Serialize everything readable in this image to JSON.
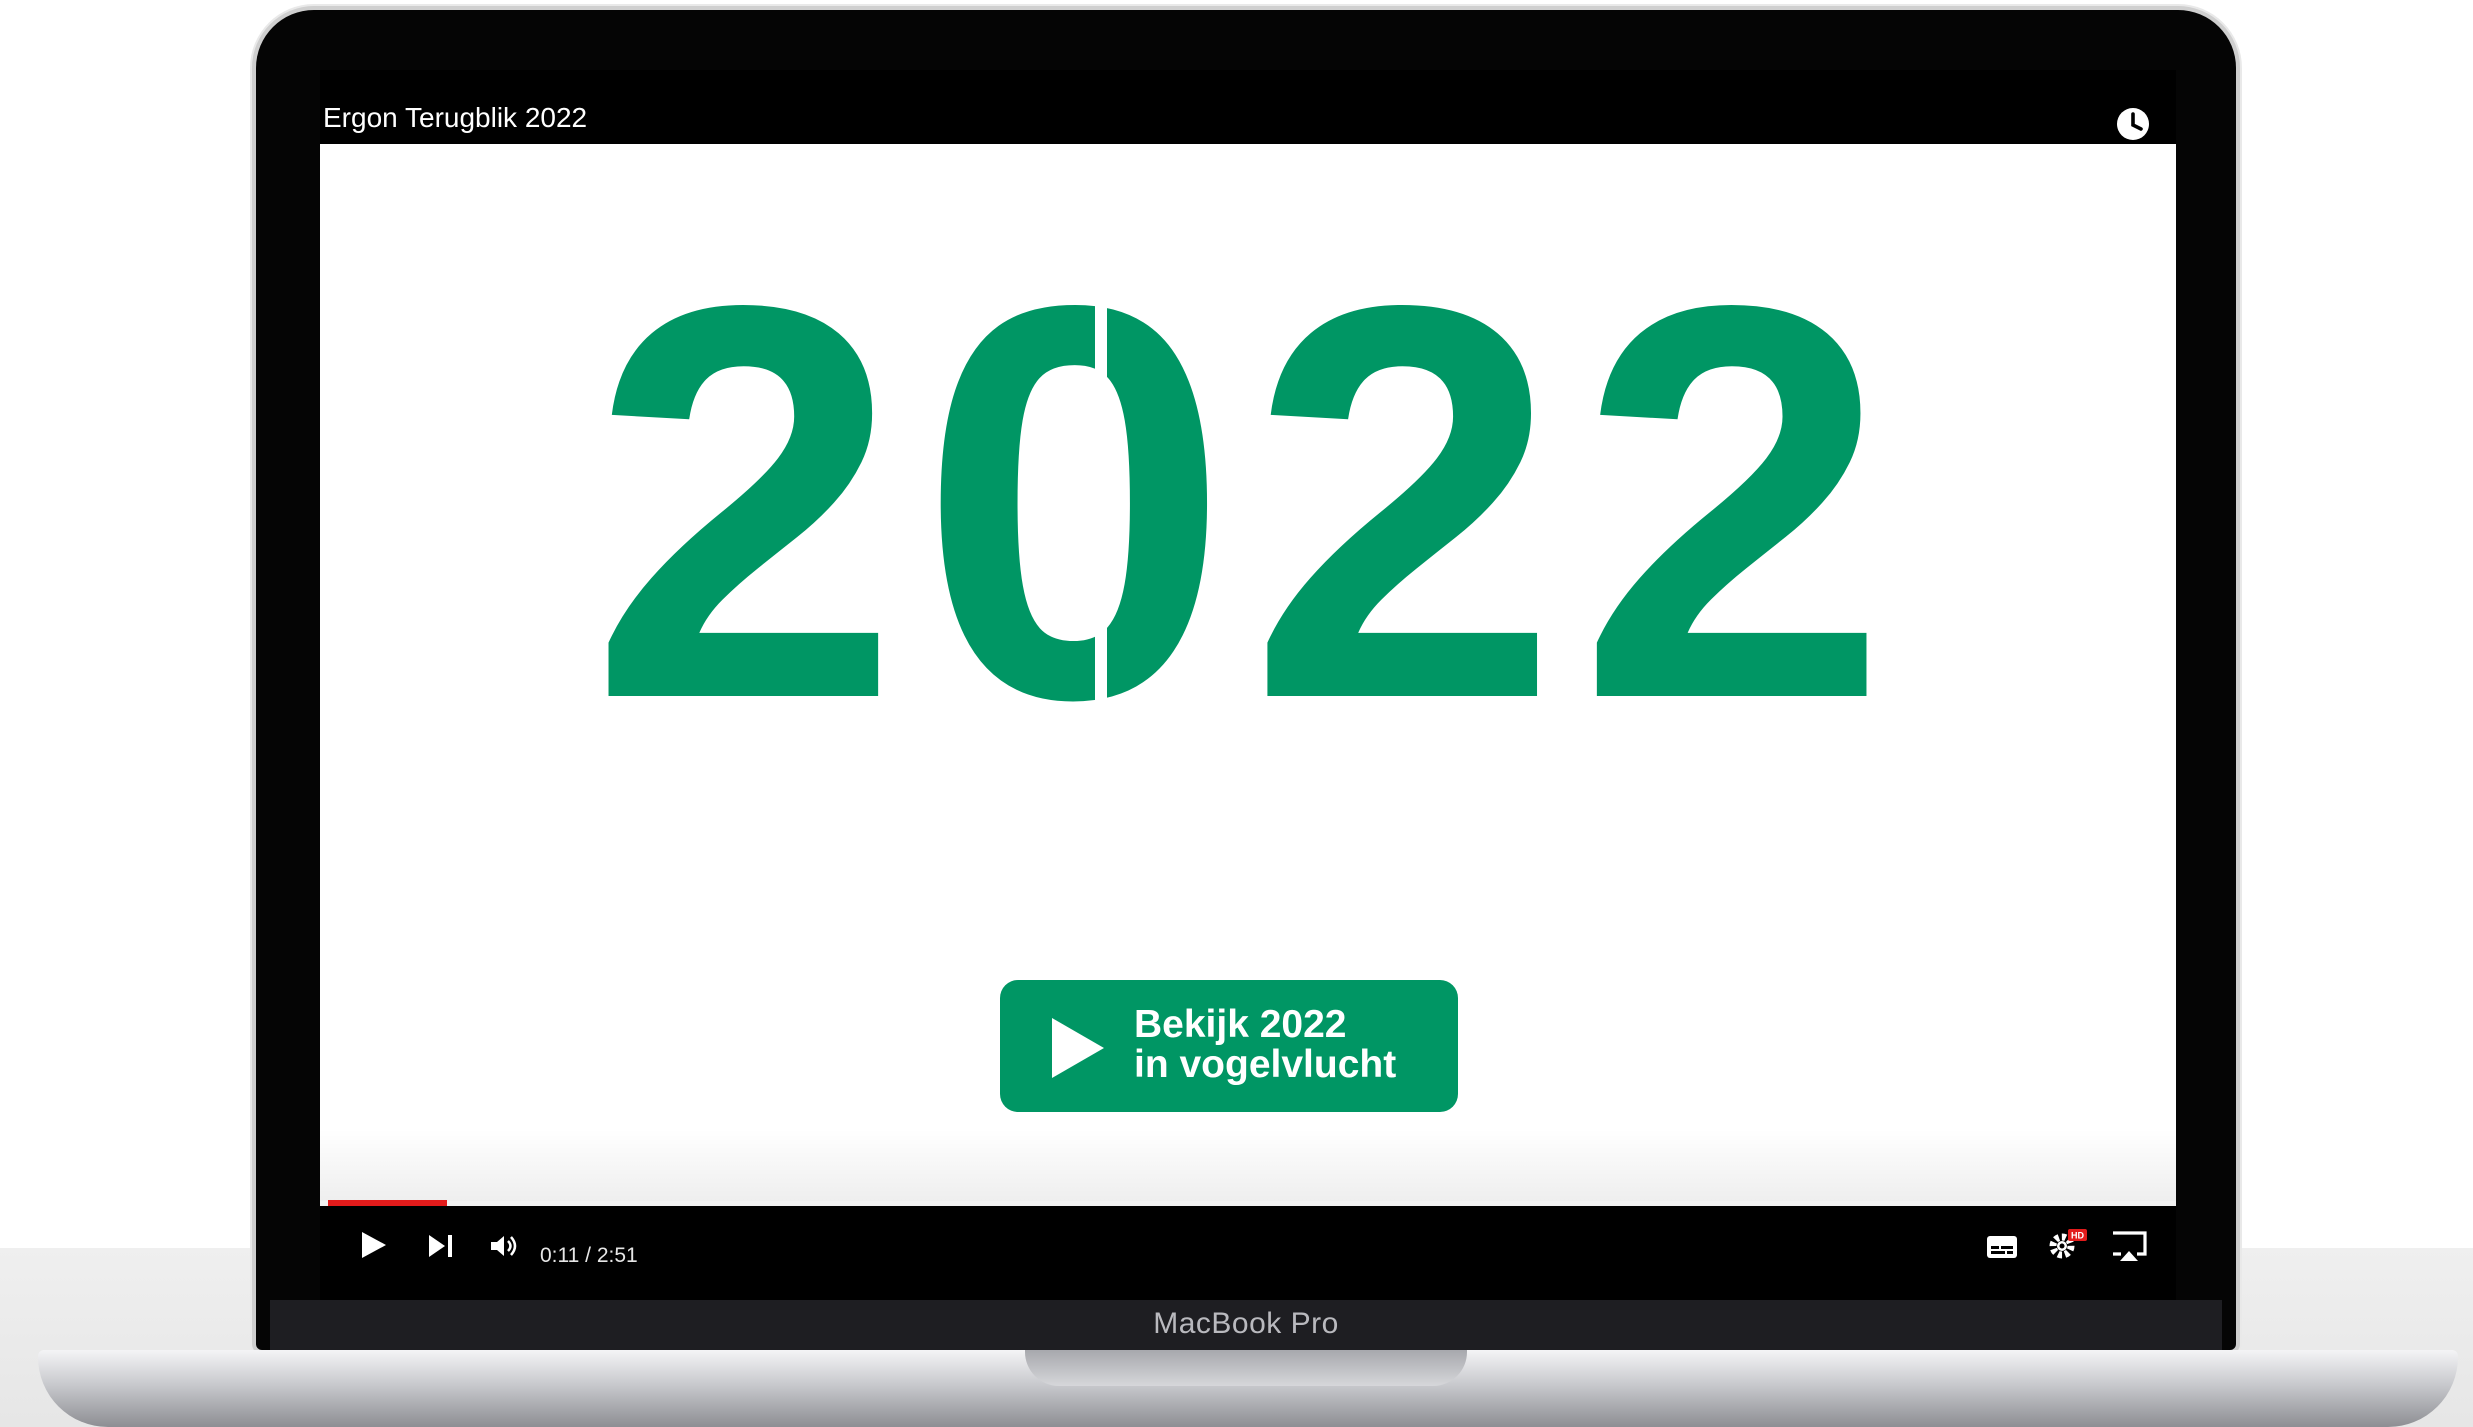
{
  "player": {
    "title": "Ergon Terugblik 2022",
    "clock_icon": "watch-later-icon",
    "video_frame": {
      "year_display": "2022",
      "brand_color": "#009664"
    },
    "cta": {
      "line1": "Bekijk 2022",
      "line2": "in vogelvlucht",
      "icon": "play-icon",
      "color": "#009664"
    },
    "progress": {
      "played_fraction": 0.064,
      "color": "#e21b1b"
    },
    "controls": {
      "play_icon": "play-icon",
      "next_icon": "skip-next-icon",
      "volume_icon": "volume-icon",
      "time": "0:11 / 2:51",
      "subtitles_icon": "subtitles-icon",
      "settings_icon": "settings-gear-icon",
      "settings_badge": "HD",
      "airplay_icon": "airplay-icon"
    }
  },
  "device": {
    "bezel_label": "MacBook Pro"
  }
}
